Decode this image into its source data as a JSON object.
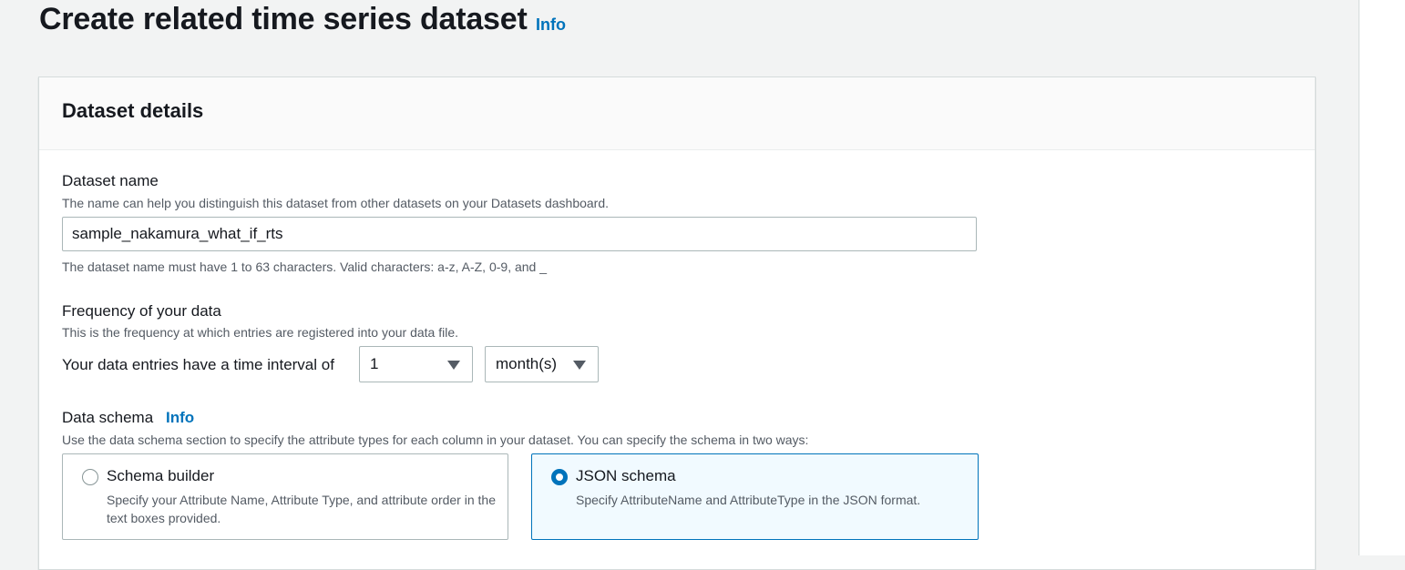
{
  "header": {
    "title": "Create related time series dataset",
    "info_link": "Info"
  },
  "panel": {
    "title": "Dataset details",
    "dataset_name": {
      "label": "Dataset name",
      "description": "The name can help you distinguish this dataset from other datasets on your Datasets dashboard.",
      "value": "sample_nakamura_what_if_rts",
      "constraint": "The dataset name must have 1 to 63 characters. Valid characters: a-z, A-Z, 0-9, and _"
    },
    "frequency": {
      "label": "Frequency of your data",
      "description": "This is the frequency at which entries are registered into your data file.",
      "interval_label": "Your data entries have a time interval of",
      "interval_value": "1",
      "unit_value": "month(s)"
    },
    "schema": {
      "label": "Data schema",
      "info_link": "Info",
      "description": "Use the data schema section to specify the attribute types for each column in your dataset. You can specify the schema in two ways:",
      "options": [
        {
          "title": "Schema builder",
          "description": "Specify your Attribute Name, Attribute Type, and attribute order in the text boxes provided.",
          "selected": false
        },
        {
          "title": "JSON schema",
          "description": "Specify AttributeName and AttributeType in the JSON format.",
          "selected": true
        }
      ]
    }
  },
  "colors": {
    "link": "#0073bb",
    "selected_tile_bg": "#f1faff",
    "page_bg": "#f2f3f3"
  },
  "icons": {
    "select_caret": "caret-down-icon",
    "radio_selected": "radio-checked-icon",
    "radio_unselected": "radio-unchecked-icon"
  }
}
